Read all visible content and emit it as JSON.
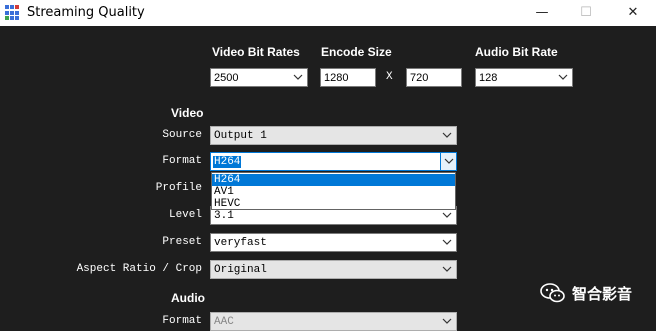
{
  "window": {
    "title": "Streaming Quality",
    "minimize_glyph": "—",
    "maximize_glyph": "☐",
    "close_glyph": "✕"
  },
  "headers": {
    "video_bit_rates": "Video Bit Rates",
    "encode_size": "Encode Size",
    "audio_bit_rate": "Audio Bit Rate"
  },
  "top_row": {
    "video_bit_rate": "2500",
    "encode_width": "1280",
    "x_separator": "X",
    "encode_height": "720",
    "audio_bit_rate": "128"
  },
  "video": {
    "section_label": "Video",
    "source_label": "Source",
    "source_value": "Output 1",
    "format_label": "Format",
    "format_value": "H264",
    "profile_label": "Profile",
    "level_label": "Level",
    "level_value": "3.1",
    "preset_label": "Preset",
    "preset_value": "veryfast",
    "aspect_label": "Aspect Ratio / Crop",
    "aspect_value": "Original"
  },
  "format_dropdown": {
    "options": [
      "H264",
      "AV1",
      "HEVC"
    ],
    "highlighted": "H264"
  },
  "audio": {
    "section_label": "Audio",
    "format_label": "Format",
    "format_value": "AAC"
  },
  "watermark": {
    "text": "智合影音",
    "icon": "wechat-bubbles-icon"
  },
  "colors": {
    "background": "#1e1e1e",
    "accent": "#0078d7",
    "titlebar": "#ffffff"
  }
}
